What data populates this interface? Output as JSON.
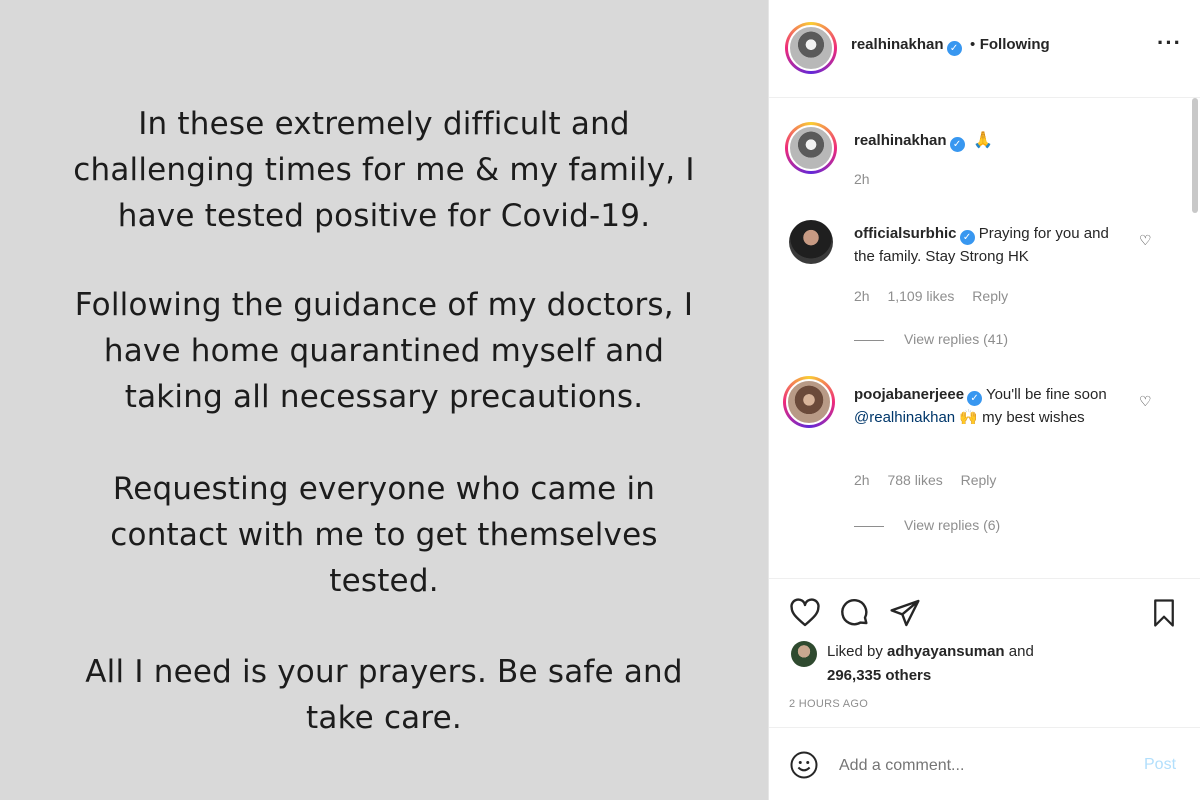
{
  "post_image": {
    "paragraphs": [
      "In these extremely difficult and\nchallenging times for me & my family, I\nhave tested positive for Covid-19.",
      "Following the guidance of my doctors, I\nhave home quarantined myself and\ntaking all necessary precautions.",
      "Requesting everyone who came in\ncontact with me to get themselves\ntested.",
      "All I need is your prayers. Be safe and\ntake care."
    ]
  },
  "header": {
    "username": "realhinakhan",
    "separator": "•",
    "follow_status": "Following",
    "more_icon": "more-dots-icon"
  },
  "caption": {
    "username": "realhinakhan",
    "text": "🙏",
    "time": "2h"
  },
  "comments": [
    {
      "username": "officialsurbhic",
      "text": "Praying for you and the family. Stay Strong HK",
      "time": "2h",
      "likes": "1,109 likes",
      "reply": "Reply",
      "view_replies": "View replies (41)"
    },
    {
      "username": "poojabanerjeee",
      "text_before": "You'll be fine soon ",
      "mention": "@realhinakhan",
      "text_after": " 🙌 my best wishes",
      "time": "2h",
      "likes": "788 likes",
      "reply": "Reply",
      "view_replies": "View replies (6)"
    }
  ],
  "actions": {
    "like_icon": "heart-icon",
    "comment_icon": "comment-icon",
    "share_icon": "paper-plane-icon",
    "save_icon": "bookmark-icon"
  },
  "likes_summary": {
    "prefix": "Liked by ",
    "user": "adhyayansuman",
    "middle": " and",
    "others": "296,335 others"
  },
  "timestamp": "2 HOURS AGO",
  "comment_box": {
    "emoji_icon": "smiley-icon",
    "placeholder": "Add a comment...",
    "post_label": "Post"
  },
  "colors": {
    "image_bg": "#d9d9d9",
    "verified": "#3897f0",
    "muted": "#8e8e8e",
    "post_disabled": "#b2dffc"
  }
}
